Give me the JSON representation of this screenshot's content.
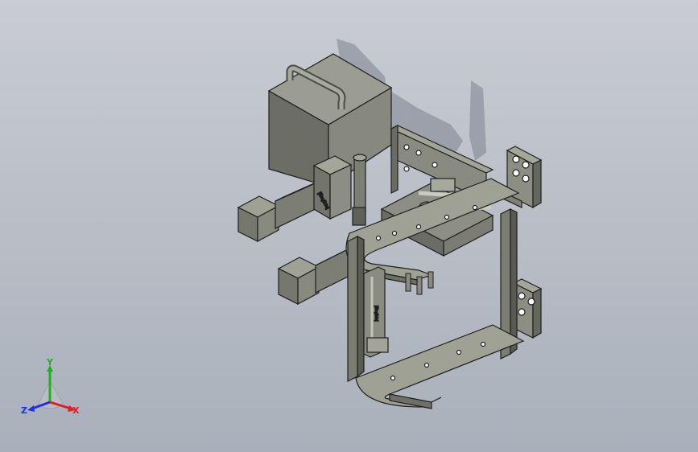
{
  "viewport": {
    "background_top": "#c9ccd2",
    "background_bottom": "#a9b0bb"
  },
  "model": {
    "steel_color": "#7b7c72",
    "steel_light": "#9a9b90",
    "steel_dark": "#55564e",
    "shadow_color": "#8f95a0",
    "edge_color": "#1e1e1e",
    "bore_color": "#ffffff",
    "cylinder_label": "[illegible]",
    "rail_label": "[illegible]"
  },
  "triad": {
    "x_label": "X",
    "y_label": "Y",
    "z_label": "Z",
    "x_color": "#e02020",
    "y_color": "#20b020",
    "z_color": "#2030e0"
  }
}
